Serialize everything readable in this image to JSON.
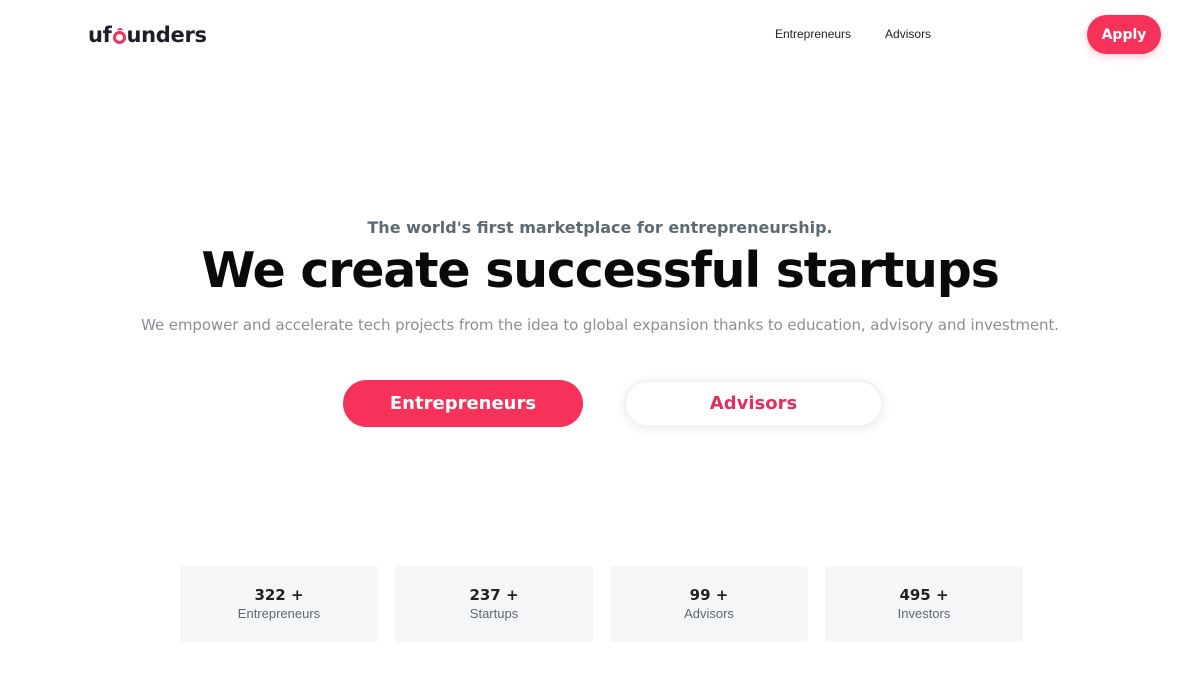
{
  "header": {
    "logo": {
      "prefix": "uf",
      "suffix": "unders",
      "accent_color": "#f0325a"
    },
    "nav": [
      {
        "label": "Entrepreneurs"
      },
      {
        "label": "Advisors"
      }
    ],
    "apply_label": "Apply"
  },
  "hero": {
    "eyebrow": "The world's first marketplace for entrepreneurship.",
    "headline": "We create successful startups",
    "subline": "We empower and accelerate tech projects from the idea to global expansion thanks to education, advisory and investment.",
    "primary_cta": "Entrepreneurs",
    "secondary_cta": "Advisors"
  },
  "stats": [
    {
      "value": "322 +",
      "label": "Entrepreneurs"
    },
    {
      "value": "237 +",
      "label": "Startups"
    },
    {
      "value": "99 +",
      "label": "Advisors"
    },
    {
      "value": "495 +",
      "label": "Investors"
    }
  ],
  "colors": {
    "brand": "#f7325a",
    "advisors_text": "#e03060",
    "stat_card_bg": "#f5f6f8"
  }
}
